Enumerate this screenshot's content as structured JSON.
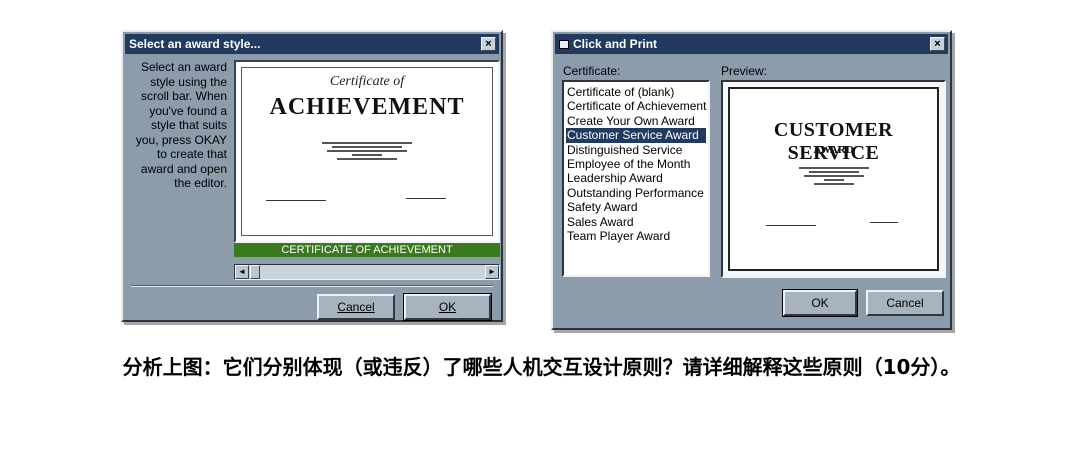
{
  "window1": {
    "title": "Select an award style...",
    "close": "×",
    "instructions": "Select an award style using the scroll bar. When you've found a style that suits you, press OKAY to create that award and open the editor.",
    "preview": {
      "script": "Certificate of",
      "heading": "ACHIEVEMENT"
    },
    "caption": "CERTIFICATE OF ACHIEVEMENT",
    "caption_color": "#3a7a1c",
    "scroll_left": "◄",
    "scroll_right": "►",
    "cancel_label": "Cancel",
    "ok_label": "OK"
  },
  "window2": {
    "title": "Click and Print",
    "close": "×",
    "certificate_label": "Certificate:",
    "preview_label": "Preview:",
    "certificates": [
      "Certificate of (blank)",
      "Certificate of Achievement",
      "Create Your Own Award",
      "Customer Service Award",
      "Distinguished Service",
      "Employee of the Month",
      "Leadership Award",
      "Outstanding Performance",
      "Safety Award",
      "Sales Award",
      "Team Player Award"
    ],
    "selected": "Customer Service Award",
    "preview": {
      "heading": "CUSTOMER SERVICE",
      "subheading": "AWARD"
    },
    "ok_label": "OK",
    "cancel_label": "Cancel"
  },
  "question": "分析上图：它们分别体现（或违反）了哪些人机交互设计原则？请详细解释这些原则（10分）。",
  "colors": {
    "titlebar": "#203a60",
    "window_face": "#8c9cab",
    "selection": "#203a60"
  }
}
